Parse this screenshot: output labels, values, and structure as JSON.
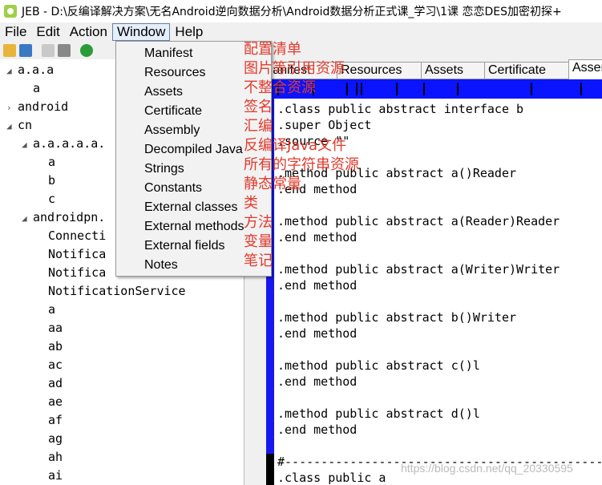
{
  "window": {
    "title": "JEB - D:\\反编译解决方案\\无名Android逆向数据分析\\Android数据分析正式课_学习\\1课 恋恋DES加密初探+"
  },
  "menubar": {
    "items": [
      "File",
      "Edit",
      "Action",
      "Window",
      "Help"
    ]
  },
  "tree": {
    "rows": [
      {
        "label": "a.a.a",
        "arrow": "◢",
        "indent": 0
      },
      {
        "label": "a",
        "arrow": "",
        "indent": 1
      },
      {
        "label": "android",
        "arrow": "›",
        "indent": 0
      },
      {
        "label": "cn",
        "arrow": "◢",
        "indent": 0
      },
      {
        "label": "a.a.a.a.a.",
        "arrow": "◢",
        "indent": 1
      },
      {
        "label": "a",
        "arrow": "",
        "indent": 2
      },
      {
        "label": "b",
        "arrow": "",
        "indent": 2
      },
      {
        "label": "c",
        "arrow": "",
        "indent": 2
      },
      {
        "label": "androidpn.",
        "arrow": "◢",
        "indent": 1
      },
      {
        "label": "Connecti",
        "arrow": "",
        "indent": 2
      },
      {
        "label": "Notifica",
        "arrow": "",
        "indent": 2
      },
      {
        "label": "Notifica",
        "arrow": "",
        "indent": 2
      },
      {
        "label": "NotificationService",
        "arrow": "",
        "indent": 2
      },
      {
        "label": "a",
        "arrow": "",
        "indent": 2
      },
      {
        "label": "aa",
        "arrow": "",
        "indent": 2
      },
      {
        "label": "ab",
        "arrow": "",
        "indent": 2
      },
      {
        "label": "ac",
        "arrow": "",
        "indent": 2
      },
      {
        "label": "ad",
        "arrow": "",
        "indent": 2
      },
      {
        "label": "ae",
        "arrow": "",
        "indent": 2
      },
      {
        "label": "af",
        "arrow": "",
        "indent": 2
      },
      {
        "label": "ag",
        "arrow": "",
        "indent": 2
      },
      {
        "label": "ah",
        "arrow": "",
        "indent": 2
      },
      {
        "label": "ai",
        "arrow": "",
        "indent": 2
      }
    ]
  },
  "tabs": [
    {
      "label": "Manifest",
      "selected": false
    },
    {
      "label": "Resources",
      "selected": false
    },
    {
      "label": "Assets",
      "selected": false
    },
    {
      "label": "Certificate",
      "selected": false
    },
    {
      "label": "Assen",
      "selected": true
    }
  ],
  "code": {
    "lines": [
      ".class public abstract interface b",
      ".super Object",
      ".source \"\"",
      "",
      ".method public abstract a()Reader",
      ".end method",
      "",
      ".method public abstract a(Reader)Reader",
      ".end method",
      "",
      ".method public abstract a(Writer)Writer",
      ".end method",
      "",
      ".method public abstract b()Writer",
      ".end method",
      "",
      ".method public abstract c()l",
      ".end method",
      "",
      ".method public abstract d()l",
      ".end method",
      "",
      "#-----------------------------------------------",
      ".class public a"
    ]
  },
  "window_menu": {
    "items": [
      "Manifest",
      "Resources",
      "Assets",
      "Certificate",
      "Assembly",
      "Decompiled Java",
      "Strings",
      "Constants",
      "External classes",
      "External methods",
      "External fields",
      "Notes"
    ]
  },
  "annotations": {
    "items": [
      "配置清单",
      "图片等引用资源",
      "不整合资源",
      "签名",
      "汇编",
      "反编译Java文件",
      "所有的字符串资源",
      "静态常量",
      "类",
      "方法",
      "变量",
      "笔记"
    ]
  },
  "watermark": "https://blog.csdn.net/qq_20330595",
  "colors": {
    "overview_blue": "#0a14ff",
    "gutter_blue": "#1717f0",
    "annotation_red": "#e23a2c"
  }
}
